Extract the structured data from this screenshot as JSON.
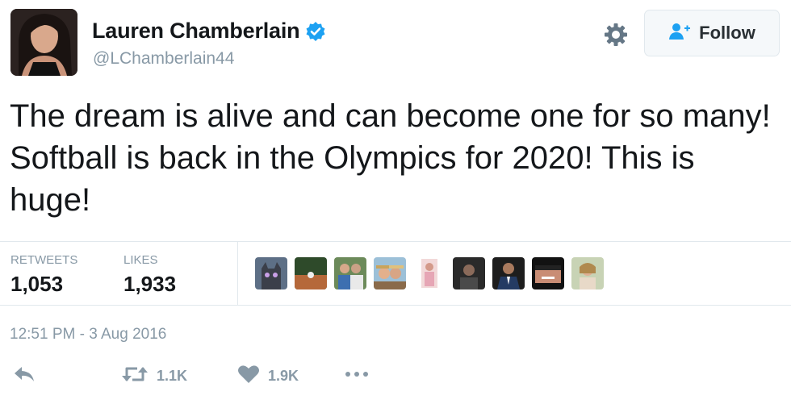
{
  "user": {
    "display_name": "Lauren Chamberlain",
    "handle": "@LChamberlain44",
    "verified": true
  },
  "follow_button": {
    "label": "Follow"
  },
  "tweet": {
    "text": "The dream is alive and can become one for so many! Softball is back in the Olympics for 2020! This is huge!"
  },
  "stats": {
    "retweets_label": "RETWEETS",
    "retweets_value": "1,053",
    "likes_label": "LIKES",
    "likes_value": "1,933"
  },
  "likers": [
    {
      "icon": "liker-avatar-cat"
    },
    {
      "icon": "liker-avatar-field"
    },
    {
      "icon": "liker-avatar-group"
    },
    {
      "icon": "liker-avatar-hats"
    },
    {
      "icon": "liker-avatar-portrait"
    },
    {
      "icon": "liker-avatar-dark"
    },
    {
      "icon": "liker-avatar-suit"
    },
    {
      "icon": "liker-avatar-smile"
    },
    {
      "icon": "liker-avatar-outdoor"
    }
  ],
  "timestamp": "12:51 PM - 3 Aug 2016",
  "actions": {
    "reply_icon": "reply-icon",
    "retweet_count": "1.1K",
    "like_count": "1.9K",
    "more_icon": "more-icon"
  },
  "colors": {
    "verified_blue": "#1da1f2",
    "secondary_text": "#8899a6",
    "primary_text": "#14171a",
    "border": "#e1e8ed"
  }
}
